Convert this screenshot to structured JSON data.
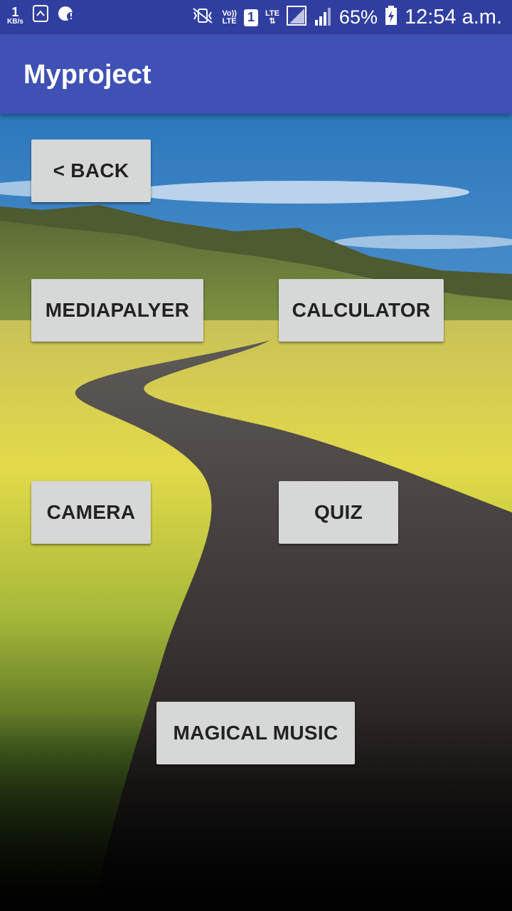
{
  "status_bar": {
    "net_speed_value": "1",
    "net_speed_unit": "KB/s",
    "volte_top": "Vo))",
    "volte_bottom": "LTE",
    "sim_slot": "1",
    "lte_label": "LTE",
    "battery_percent": "65%",
    "time": "12:54 a.m."
  },
  "app_bar": {
    "title": "Myproject"
  },
  "buttons": {
    "back": "< BACK",
    "mediaplayer": "MEDIAPALYER",
    "calculator": "CALCULATOR",
    "camera": "CAMERA",
    "quiz": "QUIZ",
    "magical_music": "MAGICAL MUSIC"
  },
  "colors": {
    "status_bar": "#303f9f",
    "app_bar": "#3f51b5",
    "button": "#d6d7d7"
  }
}
